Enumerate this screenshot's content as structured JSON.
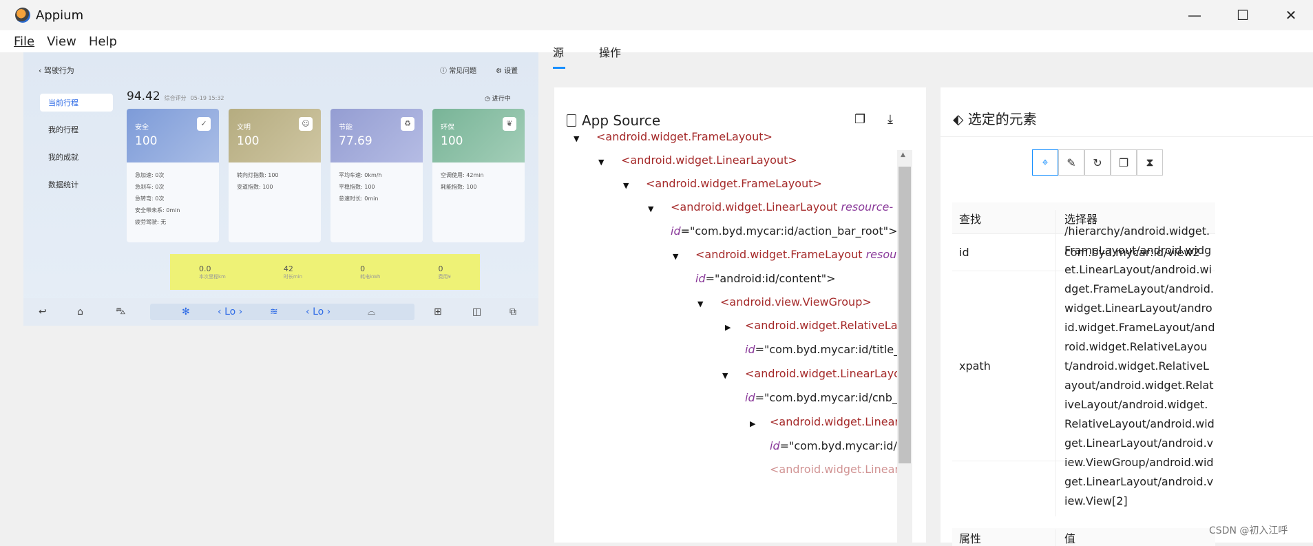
{
  "window": {
    "title": "Appium",
    "minimize": "—",
    "maximize": "☐",
    "close": "✕"
  },
  "menu": {
    "file": "File",
    "view": "View",
    "help": "Help"
  },
  "device": {
    "back_label": "驾驶行为",
    "faq": "常见问题",
    "settings": "设置",
    "score": "94.42",
    "score_label": "综合评分",
    "date": "05-19 15:32",
    "status": "进行中",
    "nav": [
      "当前行程",
      "我的行程",
      "我的成就",
      "数据统计"
    ],
    "cards": [
      {
        "name": "安全",
        "value": "100",
        "lines": [
          "急加速: 0次",
          "急刹车: 0次",
          "急转弯: 0次",
          "安全带未系: 0min",
          "疲劳驾驶: 无"
        ],
        "color": "#7d9bd8"
      },
      {
        "name": "文明",
        "value": "100",
        "lines": [
          "转向灯指数: 100",
          "变道指数: 100"
        ],
        "color": "#bdb38a"
      },
      {
        "name": "节能",
        "value": "77.69",
        "lines": [
          "平均车速: 0km/h",
          "平稳指数: 100",
          "怠速时长: 0min"
        ],
        "color": "#9aa3d6"
      },
      {
        "name": "环保",
        "value": "100",
        "lines": [
          "空调使用: 42min",
          "耗能指数: 100"
        ],
        "color": "#7fb99e"
      }
    ],
    "stats": [
      {
        "value": "0.0",
        "label": "本次里程km"
      },
      {
        "value": "42",
        "label": "时长min"
      },
      {
        "value": "0",
        "label": "耗电kWh"
      },
      {
        "value": "0",
        "label": "费用¥"
      }
    ],
    "dock_lo_1": "Lo",
    "dock_lo_2": "Lo"
  },
  "tabs": {
    "source": "源",
    "actions": "操作"
  },
  "source_panel": {
    "title": "App Source",
    "nodes": [
      {
        "tag": "<android.widget.FrameLayout>"
      },
      {
        "tag": "<android.widget.LinearLayout>"
      },
      {
        "tag": "<android.widget.FrameLayout>"
      },
      {
        "tag": "<android.widget.LinearLayout ",
        "attr": "resource-",
        "attr2": "id",
        "val": "=\"com.byd.mycar:id/action_bar_root\">"
      },
      {
        "tag": "<android.widget.FrameLayout ",
        "attr": "resource",
        "attr2": "id",
        "val": "=\"android:id/content\">"
      },
      {
        "tag": "<android.view.ViewGroup>"
      },
      {
        "tag": "<android.widget.RelativeLay",
        "attr2": "id",
        "val": "=\"com.byd.mycar:id/title_b"
      },
      {
        "tag": "<android.widget.LinearLayo",
        "attr2": "id",
        "val": "=\"com.byd.mycar:id/cnb_b"
      },
      {
        "tag": "<android.widget.Linear",
        "attr2": "id",
        "val": "=\"com.byd.mycar:id/t"
      },
      {
        "tag": "<android.widget.LinearL"
      }
    ]
  },
  "selected_panel": {
    "title": "选定的元素",
    "col_find": "查找",
    "col_selector": "选择器",
    "rows": [
      {
        "key": "id",
        "value": "com.byd.mycar:id/view2"
      },
      {
        "key": "xpath",
        "value": "/hierarchy/android.widget.FrameLayout/android.widget.LinearLayout/android.widget.FrameLayout/android.widget.LinearLayout/android.widget.FrameLayout/android.widget.RelativeLayout/android.widget.RelativeLayout/android.widget.RelativeLayout/android.widget.RelativeLayout/android.widget.LinearLayout/android.view.ViewGroup/android.widget.LinearLayout/android.view.View[2]"
      }
    ],
    "col_attr": "属性",
    "col_value": "值"
  },
  "watermark": "CSDN @初入江呼",
  "accent": "#1890ff"
}
